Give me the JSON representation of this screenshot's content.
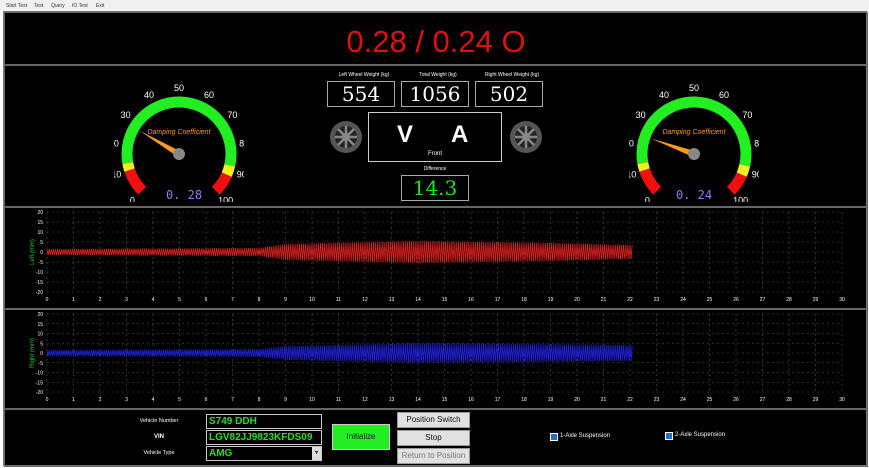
{
  "menu": [
    "Start Test",
    "Test",
    "Query",
    "IO Test",
    "Exit"
  ],
  "header": {
    "title": "0.28 / 0.24 O"
  },
  "weights": {
    "left_label": "Left Wheel Weight (kg)",
    "total_label": "Total Weight (kg)",
    "right_label": "Right Wheel Weight (kg)",
    "left_value": "554",
    "total_value": "1056",
    "right_value": "502",
    "difference_label": "Difference",
    "difference_value": "14.3"
  },
  "status": {
    "v": "V",
    "a": "A",
    "position": "Front"
  },
  "gauges": {
    "label": "Damping Coefficient",
    "ticks": [
      "0",
      "10",
      "20",
      "30",
      "40",
      "50",
      "60",
      "70",
      "80",
      "90",
      "100"
    ],
    "left_value": 0.28,
    "left_value_text": "0. 28",
    "right_value": 0.24,
    "right_value_text": "0. 24"
  },
  "charts": {
    "left_ylabel": "Left (mm)",
    "right_ylabel": "Right (mm)",
    "y_ticks": [
      "20",
      "15",
      "10",
      "5",
      "0",
      "-5",
      "-10",
      "-15",
      "-20"
    ],
    "x_ticks": [
      "0",
      "1",
      "2",
      "3",
      "4",
      "5",
      "6",
      "7",
      "8",
      "9",
      "10",
      "11",
      "12",
      "13",
      "14",
      "15",
      "16",
      "17",
      "18",
      "19",
      "20",
      "21",
      "22",
      "23",
      "24",
      "25",
      "26",
      "27",
      "28",
      "29",
      "30"
    ],
    "left_color": "#e02020",
    "right_color": "#2020e0"
  },
  "chart_data": [
    {
      "type": "line",
      "ylabel": "Left (mm)",
      "xlim": [
        0,
        30
      ],
      "ylim": [
        -20,
        20
      ],
      "grid": true,
      "series": [
        {
          "x": [
            0,
            8,
            9,
            14,
            19,
            22.1
          ],
          "amplitude": [
            1.5,
            2,
            4,
            5.5,
            4.5,
            3.5
          ]
        }
      ]
    },
    {
      "type": "line",
      "ylabel": "Right (mm)",
      "xlim": [
        0,
        30
      ],
      "ylim": [
        -20,
        20
      ],
      "grid": true,
      "series": [
        {
          "x": [
            0,
            8,
            9,
            14,
            19,
            22.1
          ],
          "amplitude": [
            1.5,
            2,
            3.5,
            5,
            4.5,
            4
          ]
        }
      ]
    }
  ],
  "form": {
    "vehicle_number_label": "Vehicle Number",
    "vehicle_number": "S749 DDH",
    "vin_label": "VIN",
    "vin": "LGV82JJ9823KFDS09",
    "vehicle_type_label": "Vehicle Type",
    "vehicle_type": "AMG",
    "initialize_label": "Initialize",
    "position_switch_label": "Position Switch",
    "stop_label": "Stop",
    "return_label": "Return to Position",
    "axle1_label": "1-Axle Suspension",
    "axle2_label": "2-Axle Suspension"
  }
}
